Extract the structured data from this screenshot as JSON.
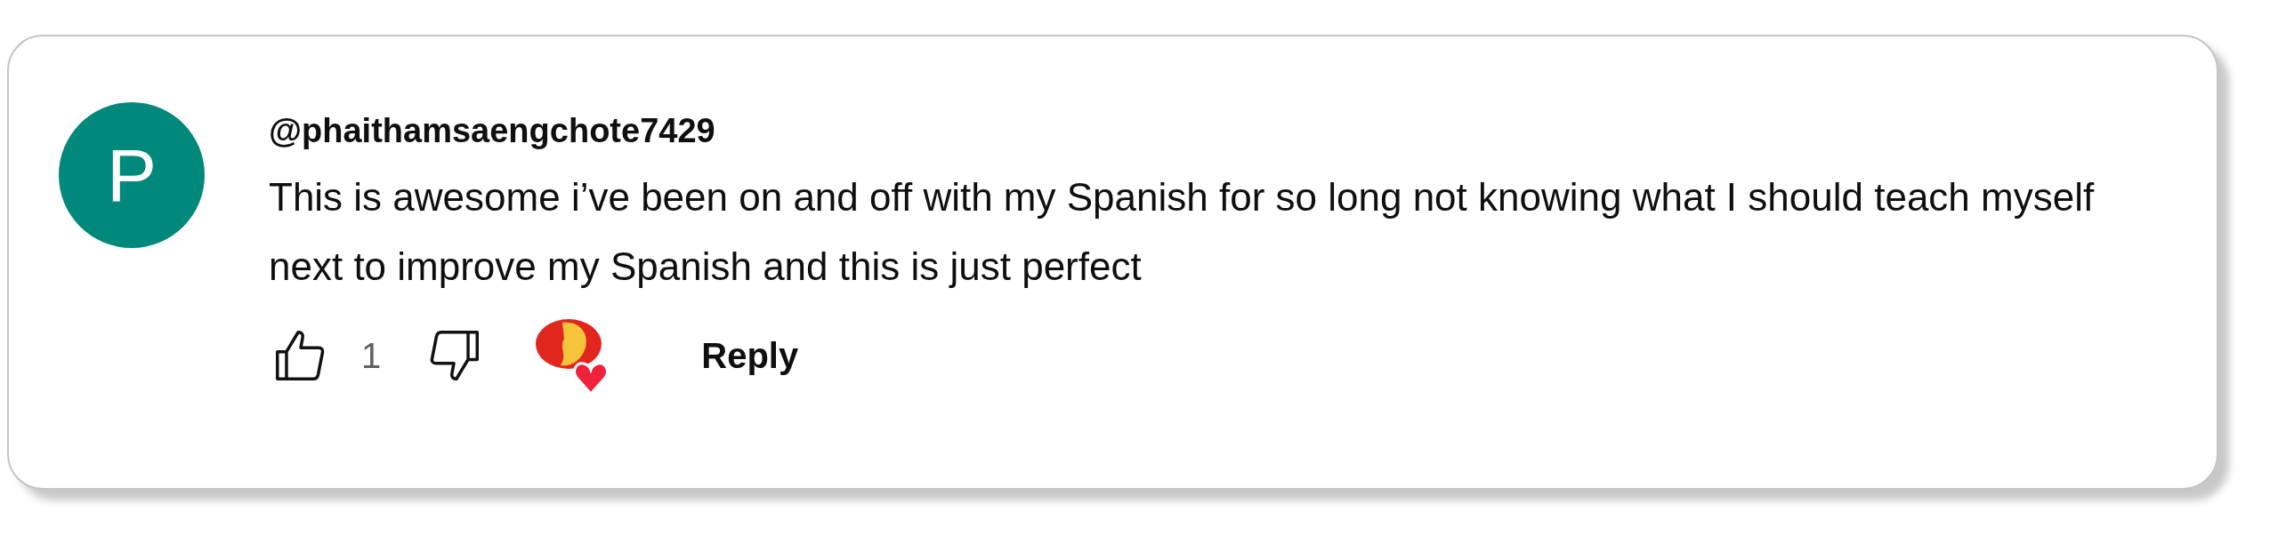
{
  "comment": {
    "avatar_letter": "P",
    "author": "@phaithamsaengchote7429",
    "text": "This is awesome i’ve been on and off with my Spanish for so long not knowing what I should teach myself next to improve my Spanish and this is just perfect",
    "like_count": "1",
    "creator_heart": true,
    "reply_label": "Reply"
  }
}
